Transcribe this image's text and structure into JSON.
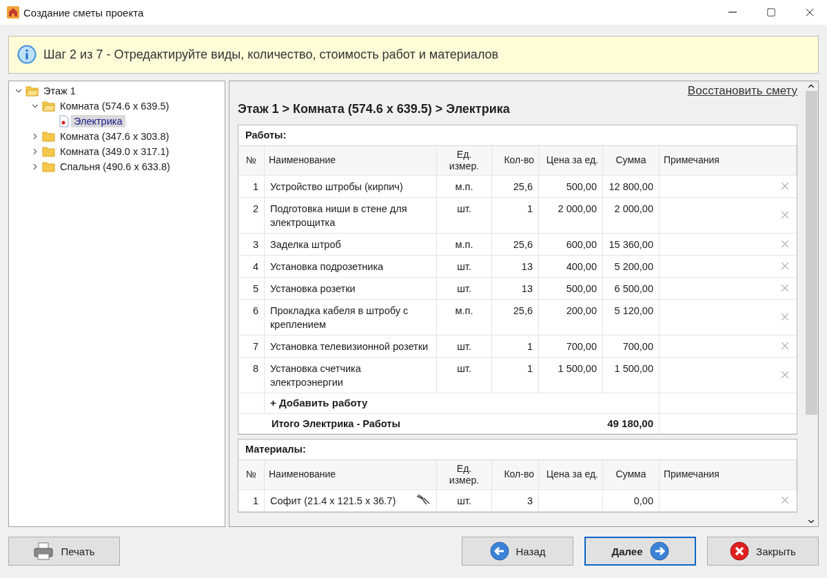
{
  "window": {
    "title": "Создание сметы проекта"
  },
  "banner": {
    "text": "Шаг 2 из 7 - Отредактируйте виды, количество, стоимость работ и материалов"
  },
  "tree": [
    {
      "label": "Этаж 1",
      "kind": "folder",
      "expanded": true,
      "selected": false,
      "children": [
        {
          "label": "Комната (574.6 x 639.5)",
          "kind": "folder",
          "expanded": true,
          "selected": false,
          "children": [
            {
              "label": "Электрика",
              "kind": "document",
              "selected": true
            }
          ]
        },
        {
          "label": "Комната (347.6 x 303.8)",
          "kind": "folder",
          "expanded": false,
          "selected": false
        },
        {
          "label": "Комната (349.0 x 317.1)",
          "kind": "folder",
          "expanded": false,
          "selected": false
        },
        {
          "label": "Спальня (490.6 x 633.8)",
          "kind": "folder",
          "expanded": false,
          "selected": false
        }
      ]
    }
  ],
  "restore_link": "Восстановить смету",
  "breadcrumb": "Этаж 1 > Комната (574.6 x 639.5) > Электрика",
  "sections": [
    {
      "title": "Работы:",
      "columns": [
        "№",
        "Наименование",
        "Ед. измер.",
        "Кол-во",
        "Цена за ед.",
        "Сумма",
        "Примечания"
      ],
      "rows": [
        {
          "number": "1",
          "name": "Устройство штробы (кирпич)",
          "unit": "м.п.",
          "qty": "25,6",
          "price": "500,00",
          "sum": "12 800,00",
          "fixture_icon": false
        },
        {
          "number": "2",
          "name": "Подготовка ниши в стене для электрощитка",
          "unit": "шт.",
          "qty": "1",
          "price": "2 000,00",
          "sum": "2 000,00",
          "fixture_icon": false
        },
        {
          "number": "3",
          "name": "Заделка штроб",
          "unit": "м.п.",
          "qty": "25,6",
          "price": "600,00",
          "sum": "15 360,00",
          "fixture_icon": false
        },
        {
          "number": "4",
          "name": "Установка подрозетника",
          "unit": "шт.",
          "qty": "13",
          "price": "400,00",
          "sum": "5 200,00",
          "fixture_icon": false
        },
        {
          "number": "5",
          "name": "Установка розетки",
          "unit": "шт.",
          "qty": "13",
          "price": "500,00",
          "sum": "6 500,00",
          "fixture_icon": false
        },
        {
          "number": "6",
          "name": "Прокладка кабеля в штробу с креплением",
          "unit": "м.п.",
          "qty": "25,6",
          "price": "200,00",
          "sum": "5 120,00",
          "fixture_icon": false
        },
        {
          "number": "7",
          "name": "Установка телевизионной розетки",
          "unit": "шт.",
          "qty": "1",
          "price": "700,00",
          "sum": "700,00",
          "fixture_icon": false
        },
        {
          "number": "8",
          "name": "Установка счетчика электроэнергии",
          "unit": "шт.",
          "qty": "1",
          "price": "1 500,00",
          "sum": "1 500,00",
          "fixture_icon": false
        }
      ],
      "add_label": "+ Добавить работу",
      "total_label": "Итого Электрика - Работы",
      "total": "49 180,00"
    },
    {
      "title": "Материалы:",
      "columns": [
        "№",
        "Наименование",
        "Ед. измер.",
        "Кол-во",
        "Цена за ед.",
        "Сумма",
        "Примечания"
      ],
      "rows": [
        {
          "number": "1",
          "name": "Софит (21.4 x 121.5 x 36.7)",
          "unit": "шт.",
          "qty": "3",
          "price": "",
          "sum": "0,00",
          "fixture_icon": true
        }
      ]
    }
  ],
  "buttons": [
    {
      "label": "Печать",
      "kind": "print",
      "default": false
    },
    {
      "label": "Назад",
      "kind": "back",
      "default": false
    },
    {
      "label": "Далее",
      "kind": "next",
      "default": true
    },
    {
      "label": "Закрыть",
      "kind": "close",
      "default": false
    }
  ]
}
